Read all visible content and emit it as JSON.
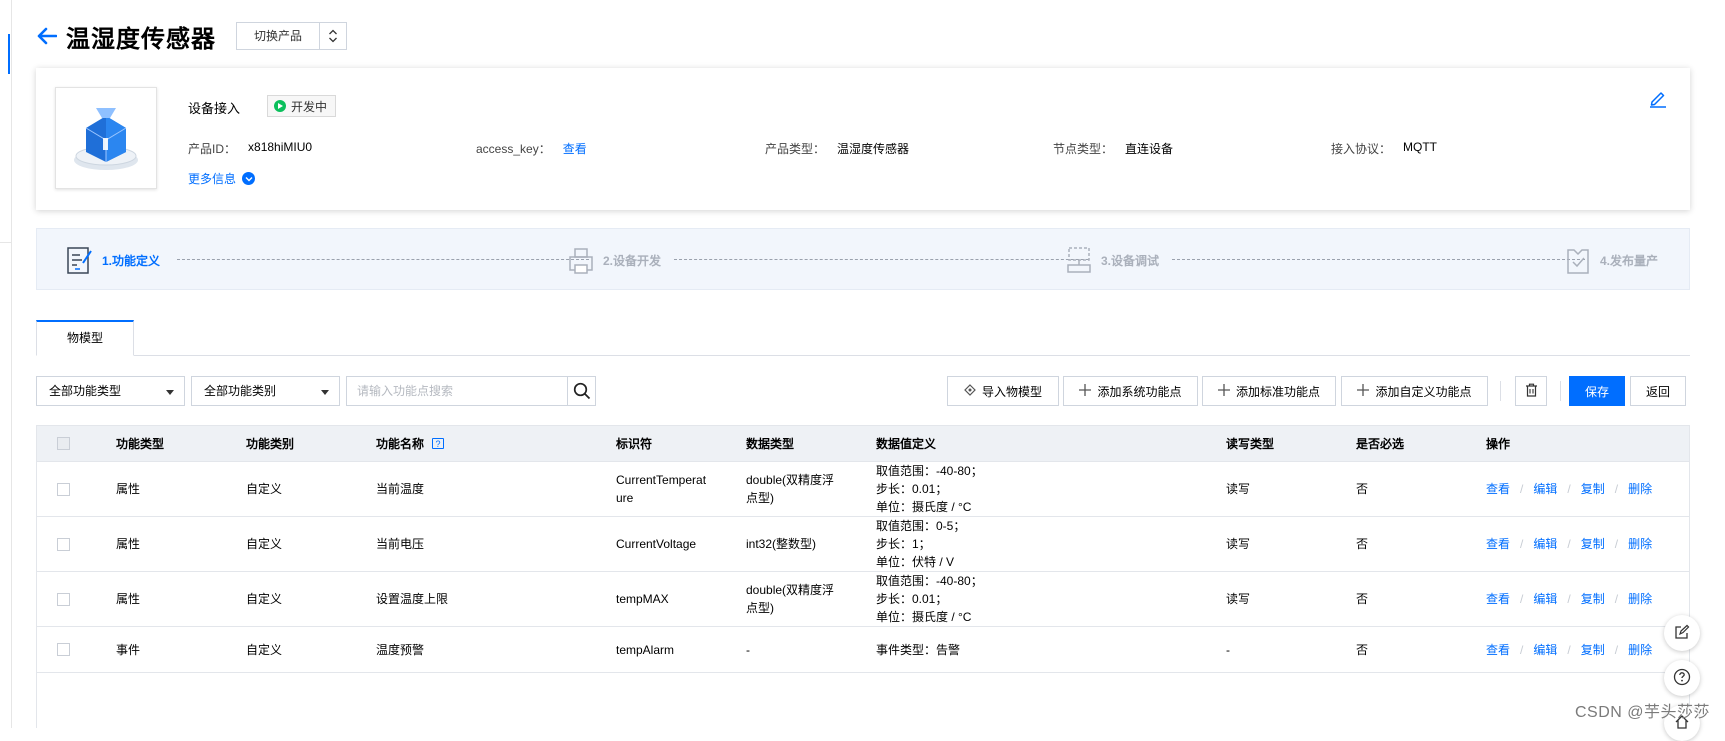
{
  "header": {
    "title": "温湿度传感器",
    "switch_label": "切换产品"
  },
  "info": {
    "section_title": "设备接入",
    "status": "开发中",
    "product_id_label": "产品ID：",
    "product_id": "x818hiMIU0",
    "access_key_label": "access_key：",
    "access_key_link": "查看",
    "product_type_label": "产品类型：",
    "product_type": "温湿度传感器",
    "node_type_label": "节点类型：",
    "node_type": "直连设备",
    "protocol_label": "接入协议：",
    "protocol": "MQTT",
    "more_info": "更多信息"
  },
  "steps": [
    {
      "label": "1.功能定义",
      "icon": "document-icon",
      "active": true
    },
    {
      "label": "2.设备开发",
      "icon": "printer-icon",
      "active": false
    },
    {
      "label": "3.设备调试",
      "icon": "debug-icon",
      "active": false
    },
    {
      "label": "4.发布量产",
      "icon": "publish-icon",
      "active": false
    }
  ],
  "tabs": [
    {
      "label": "物模型"
    }
  ],
  "toolbar": {
    "type_select": "全部功能类型",
    "category_select": "全部功能类别",
    "search_placeholder": "请输入功能点搜索",
    "import_label": "导入物模型",
    "add_system_label": "添加系统功能点",
    "add_standard_label": "添加标准功能点",
    "add_custom_label": "添加自定义功能点",
    "save_label": "保存",
    "back_label": "返回"
  },
  "table": {
    "headers": [
      "功能类型",
      "功能类别",
      "功能名称",
      "标识符",
      "数据类型",
      "数据值定义",
      "读写类型",
      "是否必选",
      "操作"
    ],
    "ops": [
      "查看",
      "编辑",
      "复制",
      "删除"
    ],
    "rows": [
      {
        "type": "属性",
        "category": "自定义",
        "name": "当前温度",
        "identifier_l1": "CurrentTemperat",
        "identifier_l2": "ure",
        "dtype_l1": "double(双精度浮",
        "dtype_l2": "点型)",
        "def_l1": "取值范围：-40-80；",
        "def_l2": "步长：0.01；",
        "def_l3": "单位：摄氏度 / °C",
        "rw": "读写",
        "required": "否"
      },
      {
        "type": "属性",
        "category": "自定义",
        "name": "当前电压",
        "identifier_l1": "CurrentVoltage",
        "identifier_l2": "",
        "dtype_l1": "int32(整数型)",
        "dtype_l2": "",
        "def_l1": "取值范围：0-5；",
        "def_l2": "步长：1；",
        "def_l3": "单位：伏特 / V",
        "rw": "读写",
        "required": "否"
      },
      {
        "type": "属性",
        "category": "自定义",
        "name": "设置温度上限",
        "identifier_l1": "tempMAX",
        "identifier_l2": "",
        "dtype_l1": "double(双精度浮",
        "dtype_l2": "点型)",
        "def_l1": "取值范围：-40-80；",
        "def_l2": "步长：0.01；",
        "def_l3": "单位：摄氏度 / °C",
        "rw": "读写",
        "required": "否"
      },
      {
        "type": "事件",
        "category": "自定义",
        "name": "温度预警",
        "identifier_l1": "tempAlarm",
        "identifier_l2": "",
        "dtype_l1": "-",
        "dtype_l2": "",
        "def_l1": "事件类型：告警",
        "def_l2": "",
        "def_l3": "",
        "rw": "-",
        "required": "否"
      }
    ]
  },
  "watermark": "CSDN @芋头莎莎",
  "colors": {
    "accent": "#006eff",
    "status_green": "#0abf5b",
    "header_bg": "#eef1f5",
    "steps_bg": "#f2f6fc"
  }
}
